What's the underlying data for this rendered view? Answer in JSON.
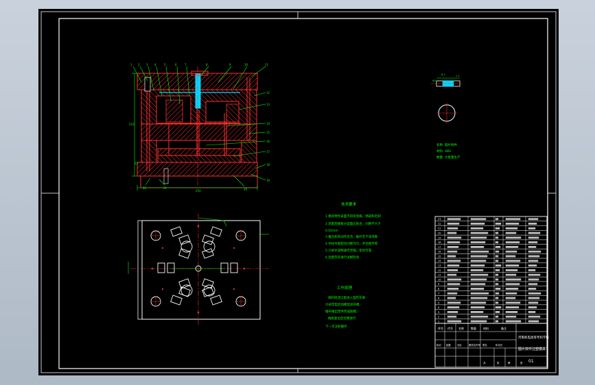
{
  "drawing": {
    "title_block": {
      "university": "河南机电高等专科学校",
      "title": "圆片双件注塑模具",
      "drawing_no": "01",
      "header_cells": [
        "序号",
        "代号",
        "名称",
        "数量",
        "材料",
        "备注"
      ],
      "sign_row": [
        "标记",
        "处数",
        "分区",
        "更改文件号",
        "签名",
        "年月日"
      ],
      "bottom_cells": [
        "共",
        "张",
        "第",
        "张"
      ],
      "parts_marks": [
        "1",
        "2",
        "3",
        "4",
        "5",
        "6",
        "7",
        "8",
        "9",
        "10",
        "11",
        "12",
        "13",
        "14",
        "15",
        "16",
        "17",
        "18",
        "19",
        "20",
        "21",
        "22",
        "23"
      ]
    },
    "notes": {
      "tech_title": "技术要求",
      "tech_lines": [
        "1.模具零件表面不得有划痕、锈斑和毛刺",
        "2.装配后模板分型面应贴合，间隙不大于",
        "0.02mm",
        "3.推出机构动作灵活，推杆无卡滞现象",
        "4.导柱导套配合间隙均匀，开合模平稳",
        "5.冷却水道畅通无泄漏，密封可靠",
        "6.装配完毕进行试模检验"
      ],
      "work_title": "工作原理",
      "work_lines": [
        "熔料经浇口套进入型腔充填",
        "冷却定型后动模后退开模，",
        "推杆推出塑件完成脱模，",
        "推板复位后合模进行",
        "下一次注射循环"
      ],
      "part_spec": [
        "名称: 圆片制件",
        "材料: ABS",
        "数量: 大批量生产"
      ]
    }
  },
  "colors": {
    "background": "#000000",
    "border": "#ffffff",
    "section": "#ff3030",
    "cavity": "#00d7ff",
    "dimension": "#00ff00",
    "ui_frame": "#b7c1cd"
  }
}
